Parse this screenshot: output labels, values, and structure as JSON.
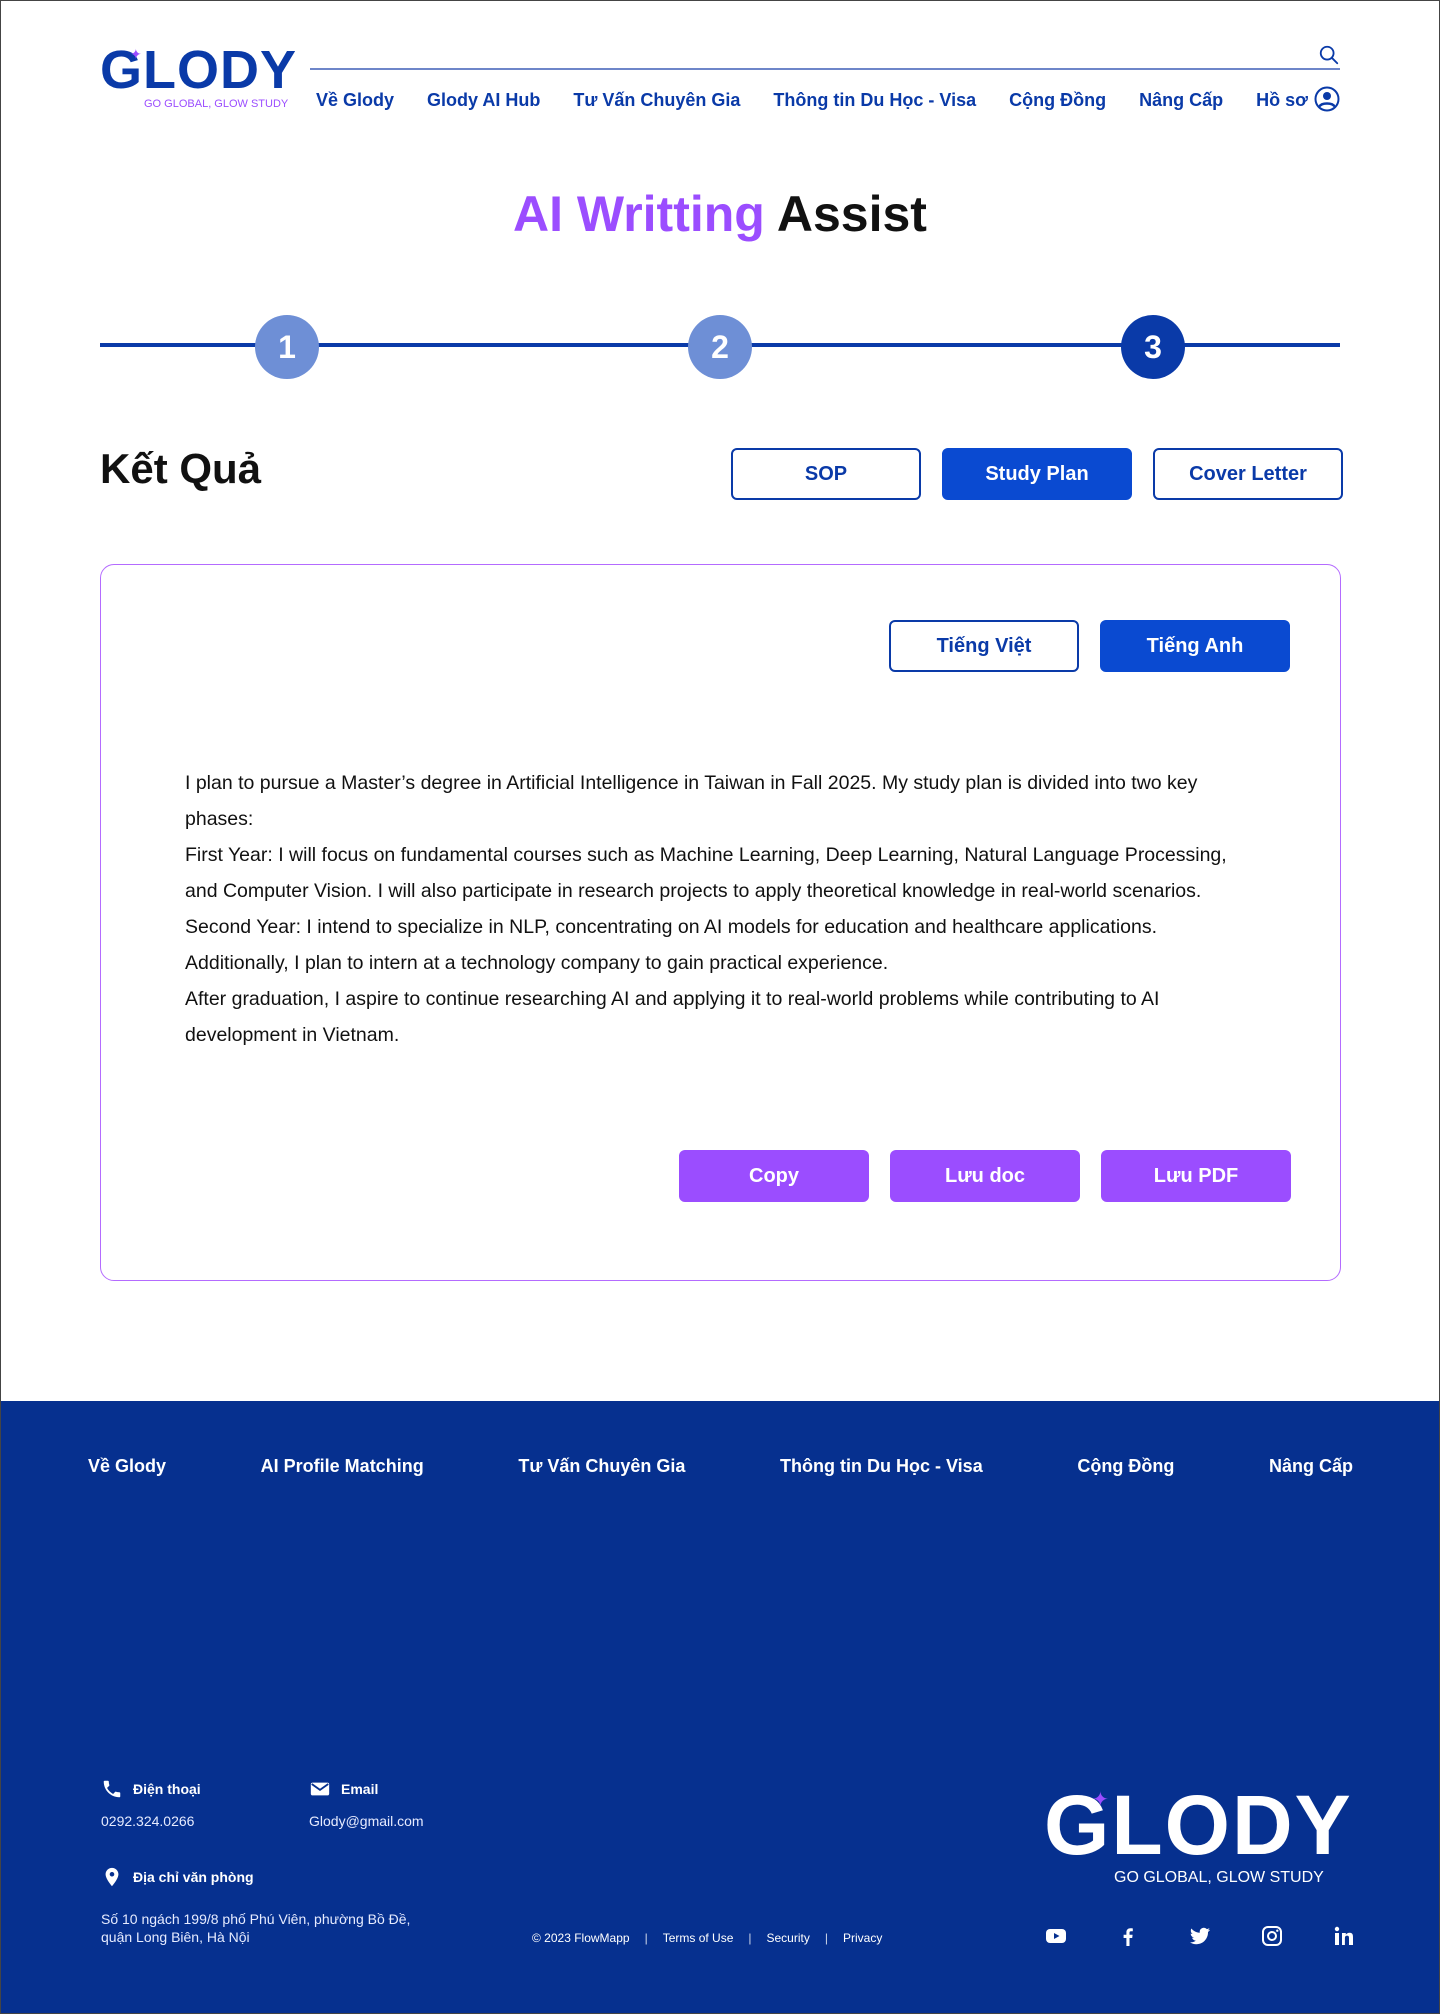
{
  "header": {
    "logo_text": "GLODY",
    "logo_tagline": "GO GLOBAL, GLOW STUDY",
    "nav": [
      "Về Glody",
      "Glody AI Hub",
      "Tư Vấn Chuyên Gia",
      "Thông tin Du Học - Visa",
      "Cộng Đồng",
      "Nâng Cấp",
      "Hồ sơ"
    ],
    "icons": {
      "search": "search-icon",
      "profile": "user-circle-icon"
    }
  },
  "page": {
    "title_accent": "AI Writting",
    "title_rest": " Assist"
  },
  "stepper": {
    "steps": [
      "1",
      "2",
      "3"
    ],
    "current_step": 3
  },
  "results": {
    "title": "Kết Quả",
    "doc_tabs": [
      "SOP",
      "Study Plan",
      "Cover Letter"
    ],
    "active_doc_tab": "Study Plan",
    "lang_tabs": [
      "Tiếng Việt",
      "Tiếng Anh"
    ],
    "active_lang_tab": "Tiếng Anh",
    "paragraphs": [
      "I plan to pursue a Master’s degree in Artificial Intelligence in Taiwan in Fall 2025. My study plan is divided into two key phases:",
      "First Year: I will focus on fundamental courses such as Machine Learning, Deep Learning, Natural Language Processing, and Computer Vision. I will also participate in research projects to apply theoretical knowledge in real-world scenarios.",
      "Second Year: I intend to specialize in NLP, concentrating on AI models for education and healthcare applications. Additionally, I plan to intern at a technology company to gain practical experience.",
      "After graduation, I aspire to continue researching AI and applying it to real-world problems while contributing to AI development in Vietnam."
    ],
    "actions": [
      "Copy",
      "Lưu doc",
      "Lưu PDF"
    ]
  },
  "footer": {
    "nav": [
      "Về Glody",
      "AI Profile Matching",
      "Tư Vấn Chuyên Gia",
      "Thông tin Du Học - Visa",
      "Cộng Đồng",
      "Nâng Cấp"
    ],
    "phone_label": "Điện thoại",
    "phone": "0292.324.0266",
    "email_label": "Email",
    "email": "Glody@gmail.com",
    "address_label": "Địa chỉ văn phòng",
    "address": "Số 10 ngách 199/8 phố Phú Viên, phường Bồ Đề, quận Long Biên, Hà Nội",
    "copyright": "© 2023 FlowMapp",
    "legal_links": [
      "Terms of Use",
      "Security",
      "Privacy"
    ],
    "logo_text": "GLODY",
    "logo_tagline": "GO GLOBAL, GLOW STUDY",
    "socials": [
      "youtube-icon",
      "facebook-icon",
      "twitter-icon",
      "instagram-icon",
      "linkedin-icon"
    ]
  },
  "colors": {
    "brand_blue": "#0a3aa8",
    "accent_purple": "#9b4dff",
    "footer_bg": "#06308f",
    "step_inactive": "#6e8fd6"
  }
}
